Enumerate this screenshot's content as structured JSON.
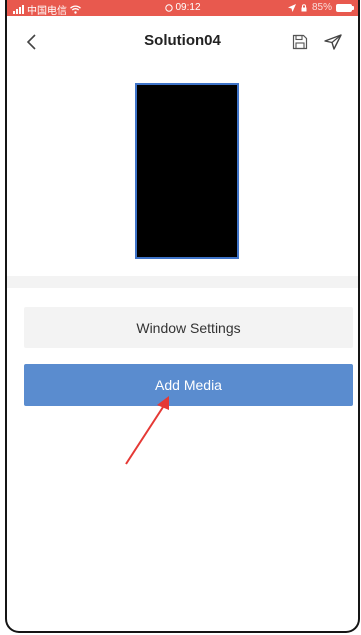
{
  "statusbar": {
    "carrier": "中国电信",
    "time": "09:12",
    "battery": "85%"
  },
  "nav": {
    "title": "Solution04"
  },
  "actions": {
    "window_settings": "Window Settings",
    "add_media": "Add Media"
  },
  "colors": {
    "status_bar": "#e8594e",
    "primary_button": "#5a8ccf",
    "secondary_button": "#f3f3f3",
    "preview_border": "#3f74c9",
    "annotation_arrow": "#e53935"
  },
  "icons": {
    "back": "chevron-left-icon",
    "save": "save-icon",
    "send": "send-icon"
  }
}
